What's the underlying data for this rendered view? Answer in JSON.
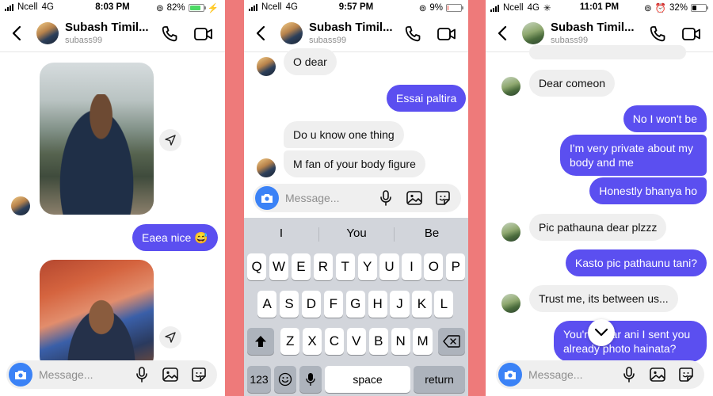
{
  "colors": {
    "accent": "#5b4ff0",
    "frame": "#ee7a7a",
    "incoming_bubble": "#efefef",
    "camera": "#3b82f6"
  },
  "panels": [
    {
      "status": {
        "carrier": "Ncell",
        "network": "4G",
        "time": "8:03 PM",
        "battery": "82%",
        "battery_level": 0.82,
        "battery_color": "#4cd964"
      },
      "header": {
        "name": "Subash Timil...",
        "username": "subass99"
      },
      "messages": {
        "m1": "Eaea nice 😅"
      },
      "composer": {
        "placeholder": "Message..."
      }
    },
    {
      "status": {
        "carrier": "Ncell",
        "network": "4G",
        "time": "9:57 PM",
        "battery": "9%",
        "battery_level": 0.09,
        "battery_color": "#ff3b30"
      },
      "header": {
        "name": "Subash Timil...",
        "username": "subass99"
      },
      "messages": {
        "m1": "O dear",
        "m2": "Essai paltira",
        "m3": "Do u know one thing",
        "m4": "M fan of your body figure"
      },
      "composer": {
        "placeholder": "Message..."
      },
      "keyboard": {
        "suggestions": [
          "I",
          "You",
          "Be"
        ],
        "row1": [
          "Q",
          "W",
          "E",
          "R",
          "T",
          "Y",
          "U",
          "I",
          "O",
          "P"
        ],
        "row2": [
          "A",
          "S",
          "D",
          "F",
          "G",
          "H",
          "J",
          "K",
          "L"
        ],
        "row3": [
          "Z",
          "X",
          "C",
          "V",
          "B",
          "N",
          "M"
        ],
        "numbers": "123",
        "space": "space",
        "return": "return"
      }
    },
    {
      "status": {
        "carrier": "Ncell",
        "network": "4G",
        "time": "11:01 PM",
        "battery": "32%",
        "battery_level": 0.32,
        "battery_color": "#000000"
      },
      "header": {
        "name": "Subash Timil...",
        "username": "subass99"
      },
      "messages": {
        "m1": "Dear comeon",
        "m2": "No I won't be",
        "m3": "I'm very private about my body and me",
        "m4": "Honestly bhanya ho",
        "m5": "Pic pathauna dear plzzz",
        "m6": "Kasto pic pathaunu tani?",
        "m7": "Trust me, its between us...",
        "m8": "You're clear ani I sent you already photo hainata?"
      },
      "composer": {
        "placeholder": "Message..."
      }
    }
  ]
}
